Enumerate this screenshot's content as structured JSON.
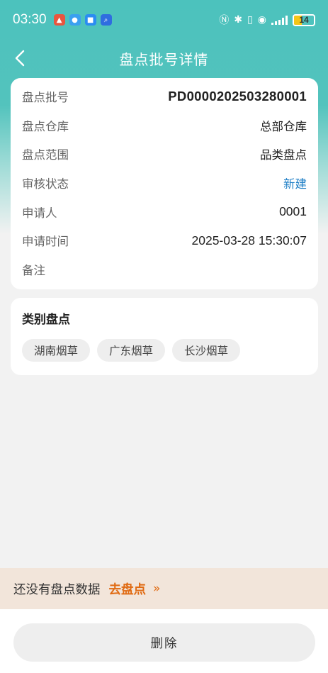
{
  "status_bar": {
    "time": "03:30",
    "battery": "14",
    "icons": [
      "wifi-icon",
      "signal-icon",
      "battery-icon",
      "nfc-icon",
      "bluetooth-icon",
      "vibrate-icon"
    ]
  },
  "header": {
    "title": "盘点批号详情",
    "back_icon": "chevron-left-icon"
  },
  "info": {
    "batch_no": {
      "label": "盘点批号",
      "value": "PD0000202503280001"
    },
    "warehouse": {
      "label": "盘点仓库",
      "value": "总部仓库"
    },
    "scope": {
      "label": "盘点范围",
      "value": "品类盘点"
    },
    "audit_status": {
      "label": "审核状态",
      "value": "新建"
    },
    "applicant": {
      "label": "申请人",
      "value": "0001"
    },
    "apply_time": {
      "label": "申请时间",
      "value": "2025-03-28 15:30:07"
    },
    "remark": {
      "label": "备注",
      "value": ""
    }
  },
  "category": {
    "title": "类别盘点",
    "tags": [
      "湖南烟草",
      "广东烟草",
      "长沙烟草"
    ]
  },
  "banner": {
    "text": "还没有盘点数据",
    "link": "去盘点",
    "chevron": "»"
  },
  "footer": {
    "delete_label": "删除"
  },
  "colors": {
    "header_teal": "#4cc2bd",
    "status_blue": "#1f7fc6",
    "link_orange": "#e06a12",
    "banner_bg": "#f2e5da"
  }
}
